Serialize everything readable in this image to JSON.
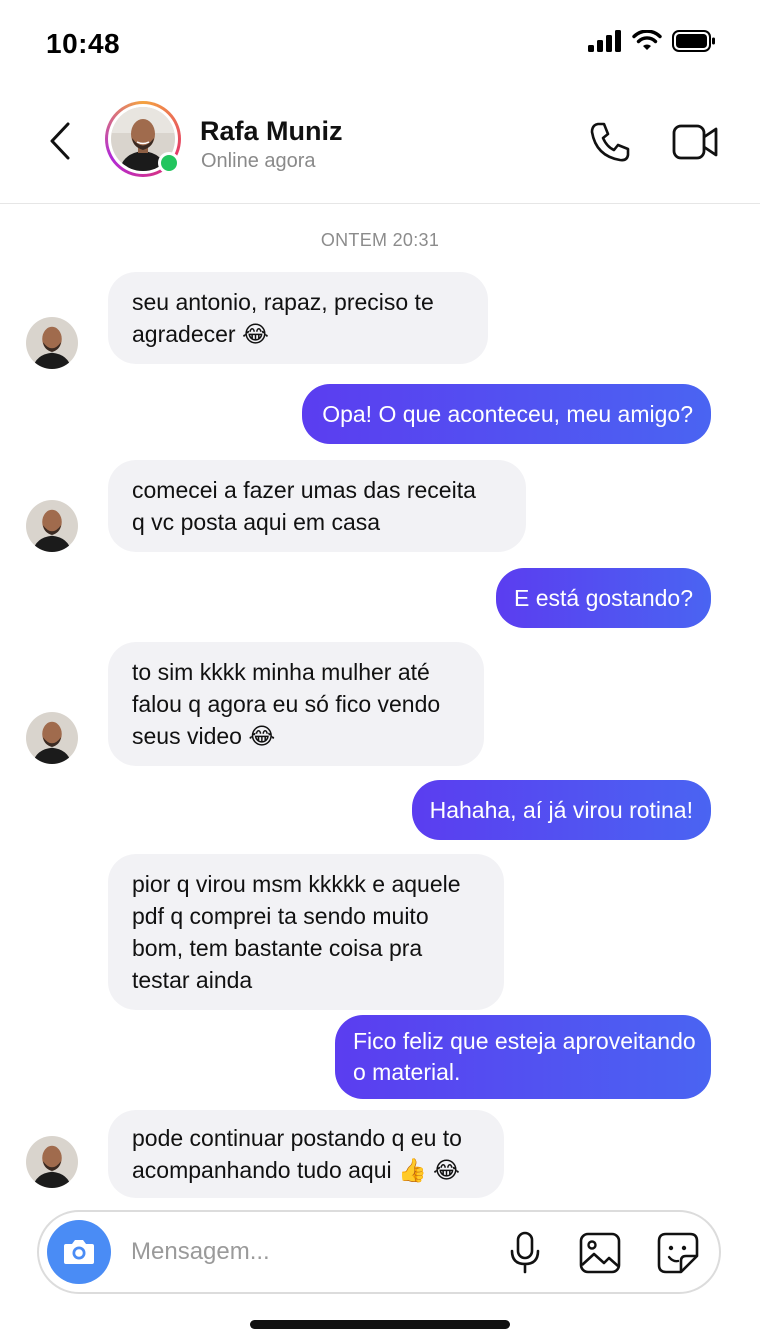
{
  "status_bar": {
    "time": "10:48"
  },
  "header": {
    "contact_name": "Rafa Muniz",
    "contact_status": "Online agora"
  },
  "chat": {
    "timestamp": "ONTEM 20:31",
    "messages": [
      {
        "direction": "incoming",
        "lines": [
          "seu antonio, rapaz, preciso te",
          "agradecer 😂"
        ]
      },
      {
        "direction": "outgoing",
        "lines": [
          "Opa! O que aconteceu, meu amigo?"
        ]
      },
      {
        "direction": "incoming",
        "lines": [
          "comecei a fazer umas das receita",
          "q vc posta aqui em casa"
        ]
      },
      {
        "direction": "outgoing",
        "lines": [
          "E está gostando?"
        ]
      },
      {
        "direction": "incoming",
        "lines": [
          "to sim kkkk minha mulher até",
          "falou q agora eu só fico vendo",
          "seus video 😂"
        ]
      },
      {
        "direction": "outgoing",
        "lines": [
          "Hahaha, aí já virou rotina!"
        ]
      },
      {
        "direction": "incoming",
        "lines": [
          "pior q virou msm kkkkk e aquele",
          "pdf q comprei ta sendo muito",
          "bom, tem bastante coisa pra",
          "testar ainda"
        ]
      },
      {
        "direction": "outgoing",
        "lines": [
          "Fico feliz que esteja aproveitando",
          "o material."
        ]
      },
      {
        "direction": "incoming",
        "lines": [
          "pode continuar postando q eu to",
          "acompanhando tudo aqui 👍 😂"
        ]
      }
    ]
  },
  "composer": {
    "placeholder": "Mensagem..."
  },
  "colors": {
    "accent_gradient_start": "#5b3df0",
    "accent_gradient_end": "#4a64f2",
    "incoming_bubble": "#f2f2f5",
    "online_dot": "#22c55e",
    "camera_button": "#4a8cf5"
  },
  "icons": {
    "back": "chevron-left-icon",
    "call": "phone-icon",
    "video": "video-camera-icon",
    "camera": "camera-icon",
    "mic": "microphone-icon",
    "image": "image-icon",
    "sticker": "sticker-icon"
  }
}
